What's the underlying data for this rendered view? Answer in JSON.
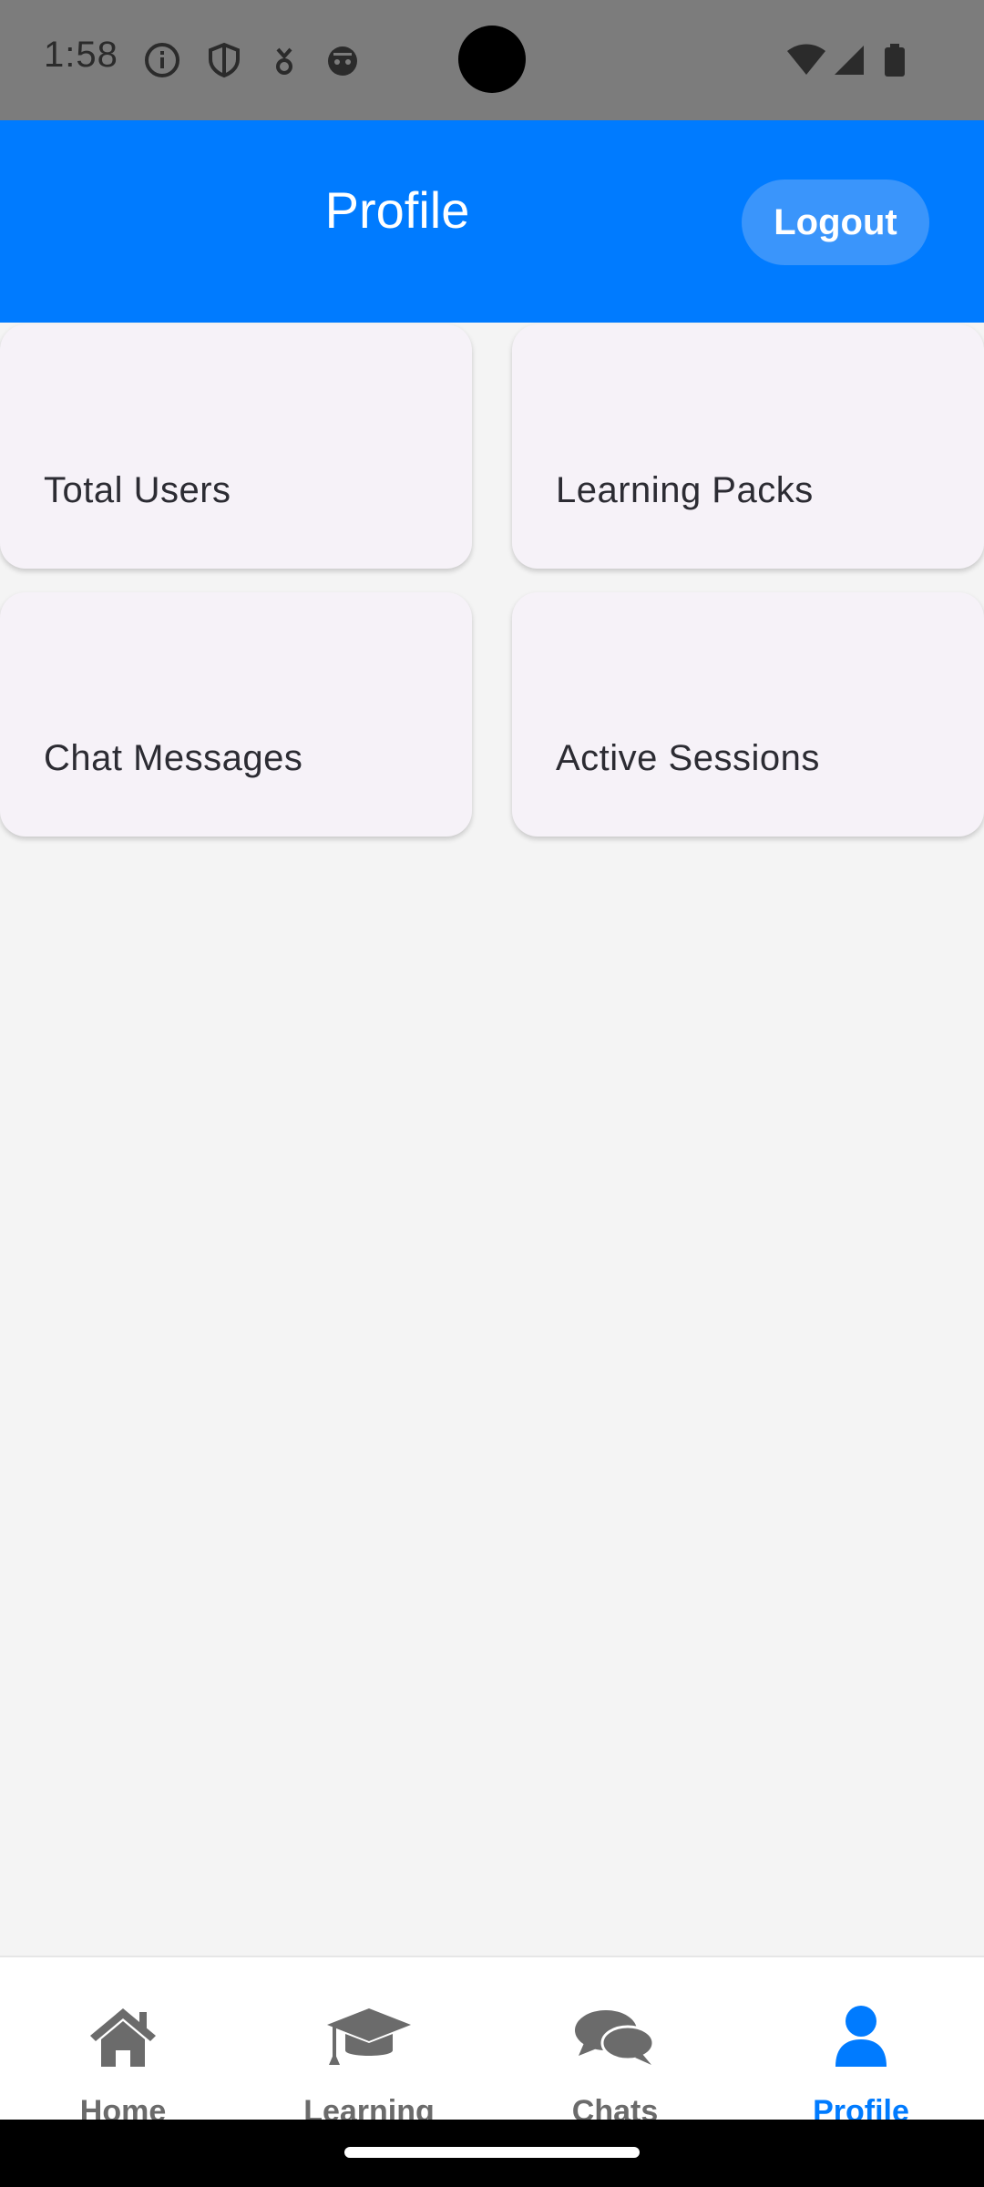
{
  "status_bar": {
    "time": "1:58",
    "icons": [
      "info-icon",
      "shield-icon",
      "download-icon",
      "cat-icon",
      "wifi-icon",
      "signal-icon",
      "battery-icon"
    ]
  },
  "header": {
    "title": "Profile",
    "logout_label": "Logout",
    "background_color": "#007bff"
  },
  "stats": {
    "cards": [
      {
        "label": "Total Users"
      },
      {
        "label": "Learning Packs"
      },
      {
        "label": "Chat Messages"
      },
      {
        "label": "Active Sessions"
      }
    ]
  },
  "bottom_nav": {
    "items": [
      {
        "label": "Home",
        "icon": "home-icon",
        "active": false
      },
      {
        "label": "Learning",
        "icon": "graduation-cap-icon",
        "active": false
      },
      {
        "label": "Chats",
        "icon": "chat-bubbles-icon",
        "active": false
      },
      {
        "label": "Profile",
        "icon": "user-icon",
        "active": true
      }
    ],
    "active_color": "#007bff",
    "inactive_color": "#6b6b6b"
  }
}
